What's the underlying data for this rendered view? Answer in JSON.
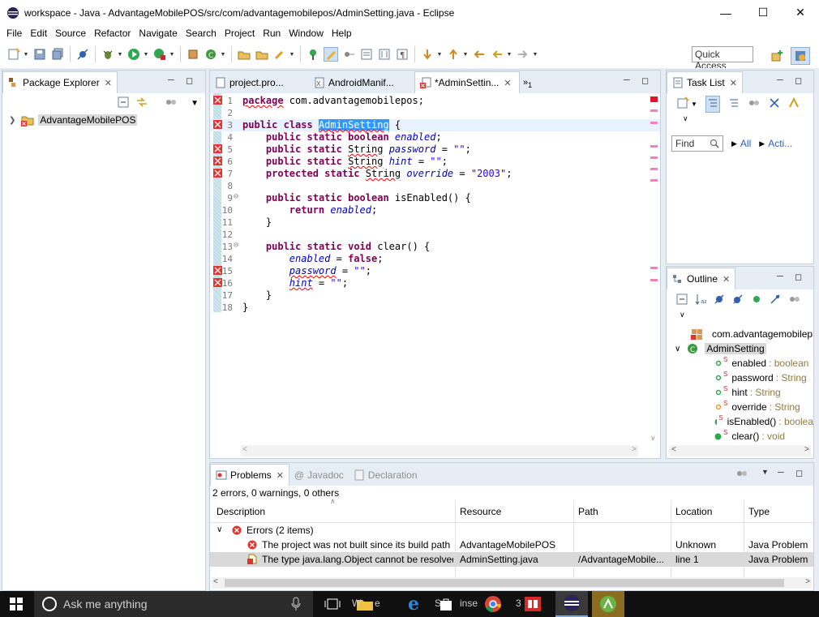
{
  "window": {
    "title": "workspace - Java - AdvantageMobilePOS/src/com/advantagemobilepos/AdminSetting.java - Eclipse"
  },
  "menu": [
    "File",
    "Edit",
    "Source",
    "Refactor",
    "Navigate",
    "Search",
    "Project",
    "Run",
    "Window",
    "Help"
  ],
  "quick_access": "Quick Access",
  "package_explorer": {
    "tab": "Package Explorer",
    "project": "AdvantageMobilePOS"
  },
  "editor": {
    "tabs": [
      "project.pro...",
      "AndroidManif...",
      "*AdminSettin..."
    ],
    "overflow": "1",
    "line_numbers": [
      "1",
      "2",
      "3",
      "4",
      "5",
      "6",
      "7",
      "8",
      "9",
      "10",
      "11",
      "12",
      "13",
      "14",
      "15",
      "16",
      "17",
      "18"
    ],
    "code": {
      "l1_kw": "package",
      "l1_rest": " com.advantagemobilepos;",
      "public": "public",
      "class": "class",
      "static": "static",
      "boolean": "boolean",
      "void": "void",
      "protected": "protected",
      "return": "return",
      "false": "false",
      "String": "String",
      "class_name": "AdminSetting",
      "f_enabled": "enabled",
      "f_password": "password",
      "f_hint": "hint",
      "f_override": "override",
      "s_empty": "\"\"",
      "s_2003": "\"2003\"",
      "m_isEnabled": " isEnabled() {",
      "m_clear": " clear() {",
      "brace_open": " {",
      "brace_close": "}",
      "eq": " = ",
      "semi": ";",
      "comma_sp": " "
    }
  },
  "task_list": {
    "tab": "Task List",
    "find": "Find",
    "all": "All",
    "activate": "Acti..."
  },
  "outline": {
    "tab": "Outline",
    "package": "com.advantagemobilep",
    "class": "AdminSetting",
    "members": [
      {
        "name": "enabled",
        "type": ": boolean"
      },
      {
        "name": "password",
        "type": ": String"
      },
      {
        "name": "hint",
        "type": ": String"
      },
      {
        "name": "override",
        "type": ": String"
      },
      {
        "name": "isEnabled()",
        "type": ": boolea"
      },
      {
        "name": "clear()",
        "type": ": void"
      }
    ]
  },
  "problems": {
    "tabs": [
      "Problems",
      "Javadoc",
      "Declaration"
    ],
    "summary": "2 errors, 0 warnings, 0 others",
    "columns": [
      "Description",
      "Resource",
      "Path",
      "Location",
      "Type"
    ],
    "group": "Errors (2 items)",
    "rows": [
      {
        "description": "The project was not built since its build path",
        "resource": "AdvantageMobilePOS",
        "path": "",
        "location": "Unknown",
        "type": "Java Problem"
      },
      {
        "description": "The type java.lang.Object cannot be resolved",
        "resource": "AdminSetting.java",
        "path": "/AdvantageMobile...",
        "location": "line 1",
        "type": "Java Problem"
      }
    ]
  },
  "taskbar": {
    "search": "Ask me anything",
    "labels": [
      "W",
      "e",
      "S",
      "inse",
      "3"
    ]
  },
  "colors": {
    "keyword": "#7f0055",
    "string": "#2a00ff",
    "field": "#0000c0",
    "error": "#e0342f",
    "workbench": "#e6edf5"
  }
}
